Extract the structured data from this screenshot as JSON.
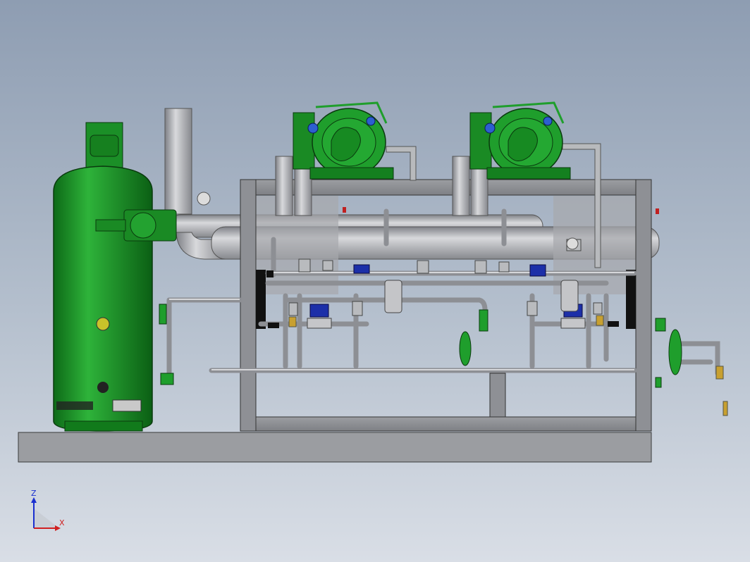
{
  "viewport": {
    "background_top": "#8e9db2",
    "background_bottom": "#d9dee6"
  },
  "colors": {
    "vessel_green": "#1e9a2a",
    "vessel_dark": "#0f6b18",
    "pipe_gray": "#a9abb0",
    "frame_gray": "#8c8f94",
    "base_gray": "#9a9ca0",
    "valve_blue": "#1c2fa8",
    "edge": "#2a2a2a"
  },
  "triad": {
    "z_label": "Z",
    "x_label": "X",
    "z_color": "#1a2fd0",
    "x_color": "#d02020"
  }
}
